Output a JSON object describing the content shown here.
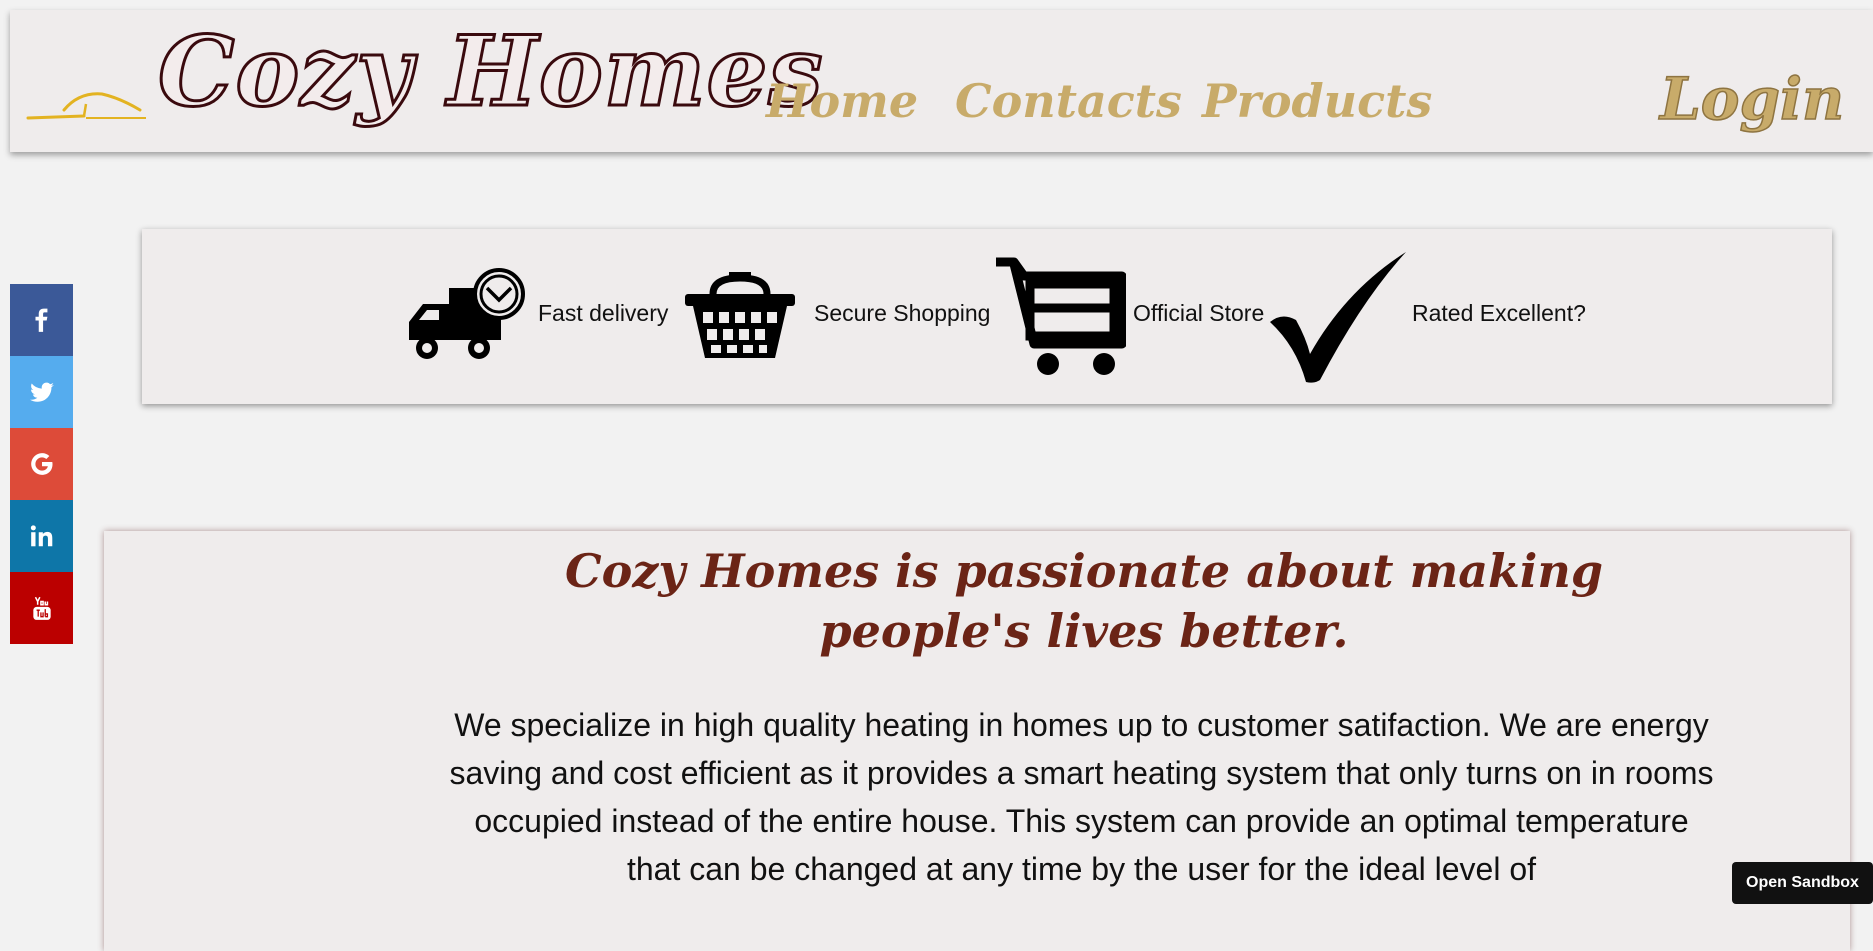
{
  "header": {
    "logo_text": "Cozy Homes",
    "logo_icon": "house-roof-icon",
    "nav": {
      "home": "Home",
      "contacts": "Contacts",
      "products": "Products",
      "login": "Login"
    }
  },
  "social": [
    {
      "name": "facebook",
      "icon": "facebook-icon",
      "color": "#3b5998"
    },
    {
      "name": "twitter",
      "icon": "twitter-icon",
      "color": "#55acee"
    },
    {
      "name": "google",
      "icon": "google-icon",
      "color": "#dd4b39"
    },
    {
      "name": "linkedin",
      "icon": "linkedin-icon",
      "color": "#0e76a8"
    },
    {
      "name": "youtube",
      "icon": "youtube-icon",
      "color": "#bb0000"
    }
  ],
  "features": [
    {
      "label": "Fast delivery",
      "icon": "delivery-truck-icon"
    },
    {
      "label": "Secure Shopping",
      "icon": "shopping-basket-icon"
    },
    {
      "label": "Official Store",
      "icon": "shopping-cart-icon"
    },
    {
      "label": "Rated Excellent?",
      "icon": "checkmark-icon"
    }
  ],
  "about": {
    "title": "Cozy Homes is passionate about making people's lives better.",
    "body": "We specialize in high quality heating in homes up to customer satifaction. We are energy saving and cost efficient as it provides a smart heating system that only turns on in rooms occupied instead of the entire house. This system can provide an optimal temperature that can be changed at any time by the user for the ideal level of"
  },
  "sandbox": {
    "label": "Open Sandbox"
  },
  "colors": {
    "accent_gold": "#c8ab6a",
    "logo_dark": "#3a0a0e",
    "title_brown": "#6b2416",
    "panel_bg": "#efecec",
    "page_bg": "#f2f2f2"
  }
}
